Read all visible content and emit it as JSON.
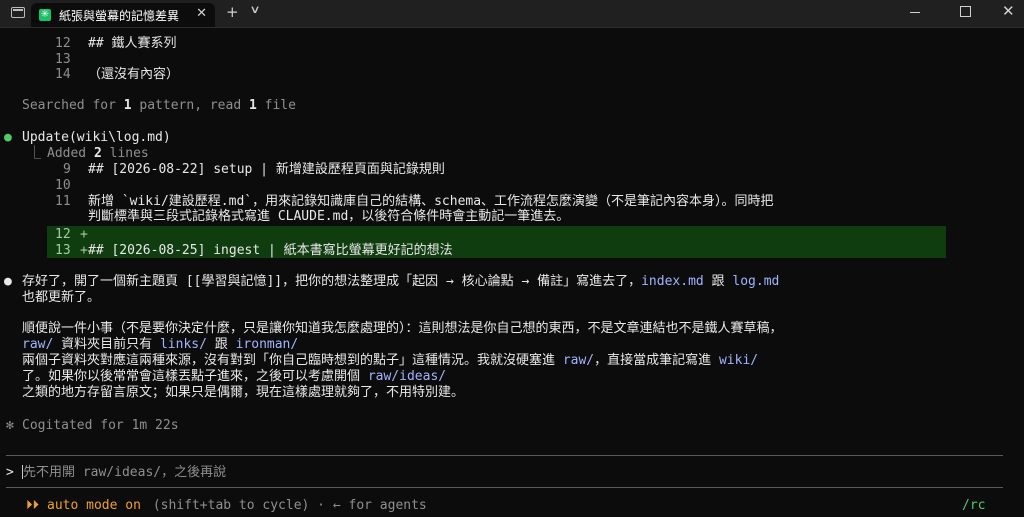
{
  "window": {
    "tab_title": "紙張與螢幕的記憶差異",
    "tab_icon": "✳",
    "close_glyph": "✕",
    "new_tab_glyph": "+",
    "dropdown_glyph": "∨",
    "close_window_glyph": "✕"
  },
  "top_lines": [
    {
      "num": "12",
      "text": "## 鐵人賽系列"
    },
    {
      "num": "13",
      "text": ""
    },
    {
      "num": "14",
      "text": "（還沒有內容）"
    }
  ],
  "searched": {
    "prefix": "Searched for ",
    "n1": "1",
    "mid": " pattern, read ",
    "n2": "1",
    "suffix": " file"
  },
  "update": {
    "bullet": "●",
    "label": "Update(wiki\\log.md)",
    "tree_glyph": "⎿",
    "added_prefix": "Added ",
    "added_count": "2",
    "added_suffix": " lines"
  },
  "diff": [
    {
      "num": "9",
      "marker": "",
      "text": "## [2026-08-22] setup | 新增建設歷程頁面與記錄規則"
    },
    {
      "num": "10",
      "marker": "",
      "text": ""
    },
    {
      "num": "11",
      "marker": "",
      "text": "新增 `wiki/建設歷程.md`，用來記錄知識庫自己的結構、schema、工作流程怎麼演變（不是筆記內容本身）。同時把"
    },
    {
      "num": "",
      "marker": "",
      "text": "判斷標準與三段式記錄格式寫進 CLAUDE.md，以後符合條件時會主動記一筆進去。"
    },
    {
      "num": "12",
      "marker": "+",
      "text": ""
    },
    {
      "num": "13",
      "marker": "+",
      "text": "## [2026-08-25] ingest | 紙本書寫比螢幕更好記的想法"
    }
  ],
  "reply": {
    "bullet": "●",
    "p1_a": "存好了，開了一個新主題頁 [[學習與記憶]]，把你的想法整理成「起因 → 核心論點 → 備註」寫進去了，",
    "p1_index": "index.md",
    "p1_and": " 跟 ",
    "p1_log": "log.md",
    "p1_b": "也都更新了。",
    "p2_l1": "順便說一件小事（不是要你決定什麼，只是讓你知道我怎麼處理的）：這則想法是你自己想的東西，不是文章連結也不是鐵人賽草稿，",
    "p2_raw": "raw/",
    "p2_l2a": " 資料夾目前只有 ",
    "p2_links": "links/",
    "p2_l2b": " 跟 ",
    "p2_iron": "ironman/",
    "p2_l3a": "兩個子資料夾對應這兩種來源，沒有對到「你自己臨時想到的點子」這種情況。我就沒硬塞進 ",
    "p2_raw2": "raw/",
    "p2_l3b": "，直接當成筆記寫進 ",
    "p2_wiki": "wiki/",
    "p2_l4a": "了。如果你以後常常會這樣丟點子進來，之後可以考慮開個 ",
    "p2_ideas": "raw/ideas/",
    "p2_l5": "之類的地方存留言原文；如果只是偶爾，現在這樣處理就夠了，不用特別建。"
  },
  "cogitated": {
    "glyph": "✻",
    "text": "Cogitated for 1m 22s"
  },
  "prompt": {
    "symbol": ">",
    "placeholder": "先不用開 raw/ideas/，之後再說"
  },
  "status": {
    "arrows": "⏵⏵",
    "mode": "auto mode on",
    "hint": " (shift+tab to cycle) · ← for agents",
    "right": "/rc"
  },
  "colors": {
    "background": "#0c0c0c",
    "added_line_bg": "#0f3d0f",
    "path_blue": "#a0b4ff",
    "bullet_green": "#4ec96b",
    "mode_amber": "#f0a030"
  }
}
